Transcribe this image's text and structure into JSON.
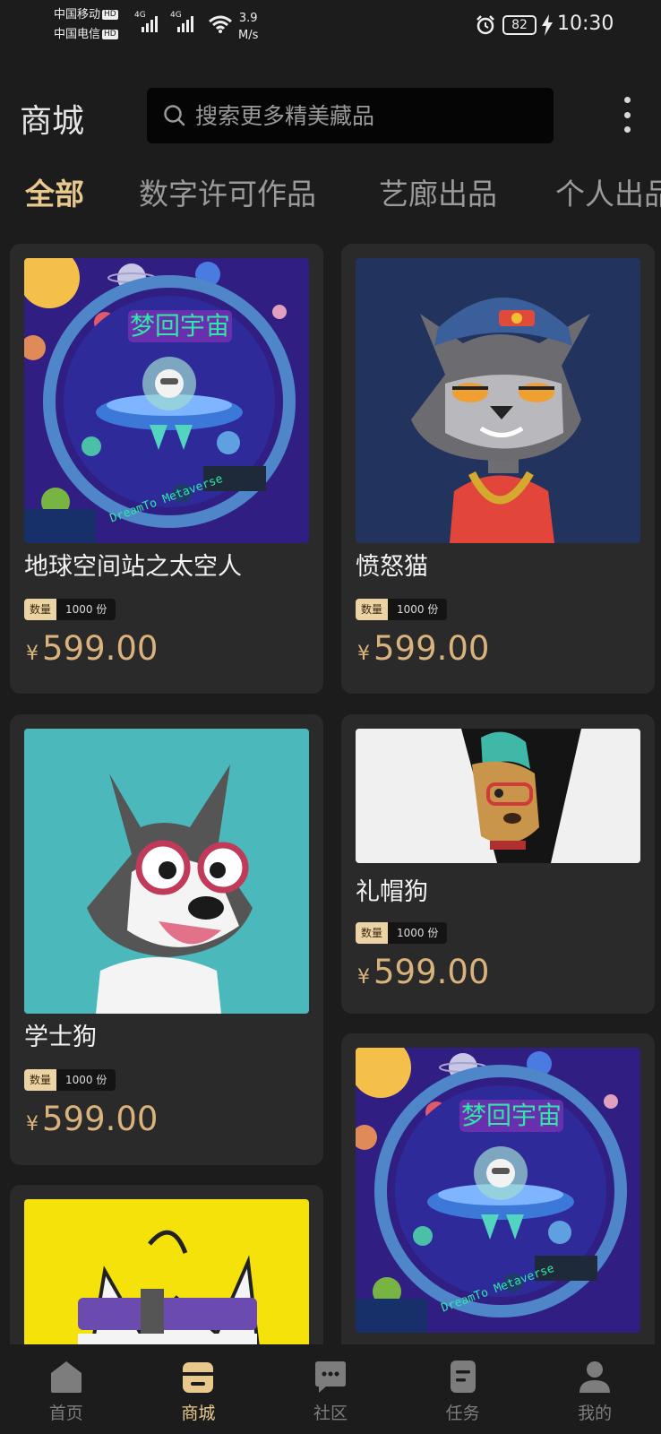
{
  "status_bar": {
    "carrier_1": "中国移动",
    "carrier_2": "中国电信",
    "hd": "HD",
    "net_1": "4G",
    "net_2": "4G",
    "speed_value": "3.9",
    "speed_unit": "M/s",
    "battery": "82",
    "time": "10:30"
  },
  "header": {
    "title": "商城",
    "search_placeholder": "搜索更多精美藏品"
  },
  "tabs": [
    {
      "label": "全部",
      "active": true
    },
    {
      "label": "数字许可作品",
      "active": false
    },
    {
      "label": "艺廊出品",
      "active": false
    },
    {
      "label": "个人出品",
      "active": false
    }
  ],
  "products": [
    {
      "title": "地球空间站之太空人",
      "qty_label": "数量",
      "qty_value": "1000 份",
      "currency": "¥",
      "price": "599.00",
      "art": "space-station-art"
    },
    {
      "title": "愤怒猫",
      "qty_label": "数量",
      "qty_value": "1000 份",
      "currency": "¥",
      "price": "599.00",
      "art": "angry-cat-art"
    },
    {
      "title": "学士狗",
      "qty_label": "数量",
      "qty_value": "1000 份",
      "currency": "¥",
      "price": "599.00",
      "art": "husky-glasses-art"
    },
    {
      "title": "礼帽狗",
      "qty_label": "数量",
      "qty_value": "1000 份",
      "currency": "¥",
      "price": "599.00",
      "art": "hat-dog-art"
    },
    {
      "title": "",
      "art": "white-dog-yellow-art"
    },
    {
      "title": "",
      "art": "space-station-art"
    }
  ],
  "artwork_text": {
    "banner": "梦回宇宙",
    "ring": "DreamTo Metaverse"
  },
  "bottom_nav": [
    {
      "label": "首页",
      "icon": "home-icon",
      "active": false
    },
    {
      "label": "商城",
      "icon": "shop-icon",
      "active": true
    },
    {
      "label": "社区",
      "icon": "community-icon",
      "active": false
    },
    {
      "label": "任务",
      "icon": "task-icon",
      "active": false
    },
    {
      "label": "我的",
      "icon": "profile-icon",
      "active": false
    }
  ],
  "colors": {
    "background": "#1c1c1c",
    "card": "#2a2a2a",
    "accent_gold": "#e9c88e",
    "price": "#d9b27c"
  }
}
